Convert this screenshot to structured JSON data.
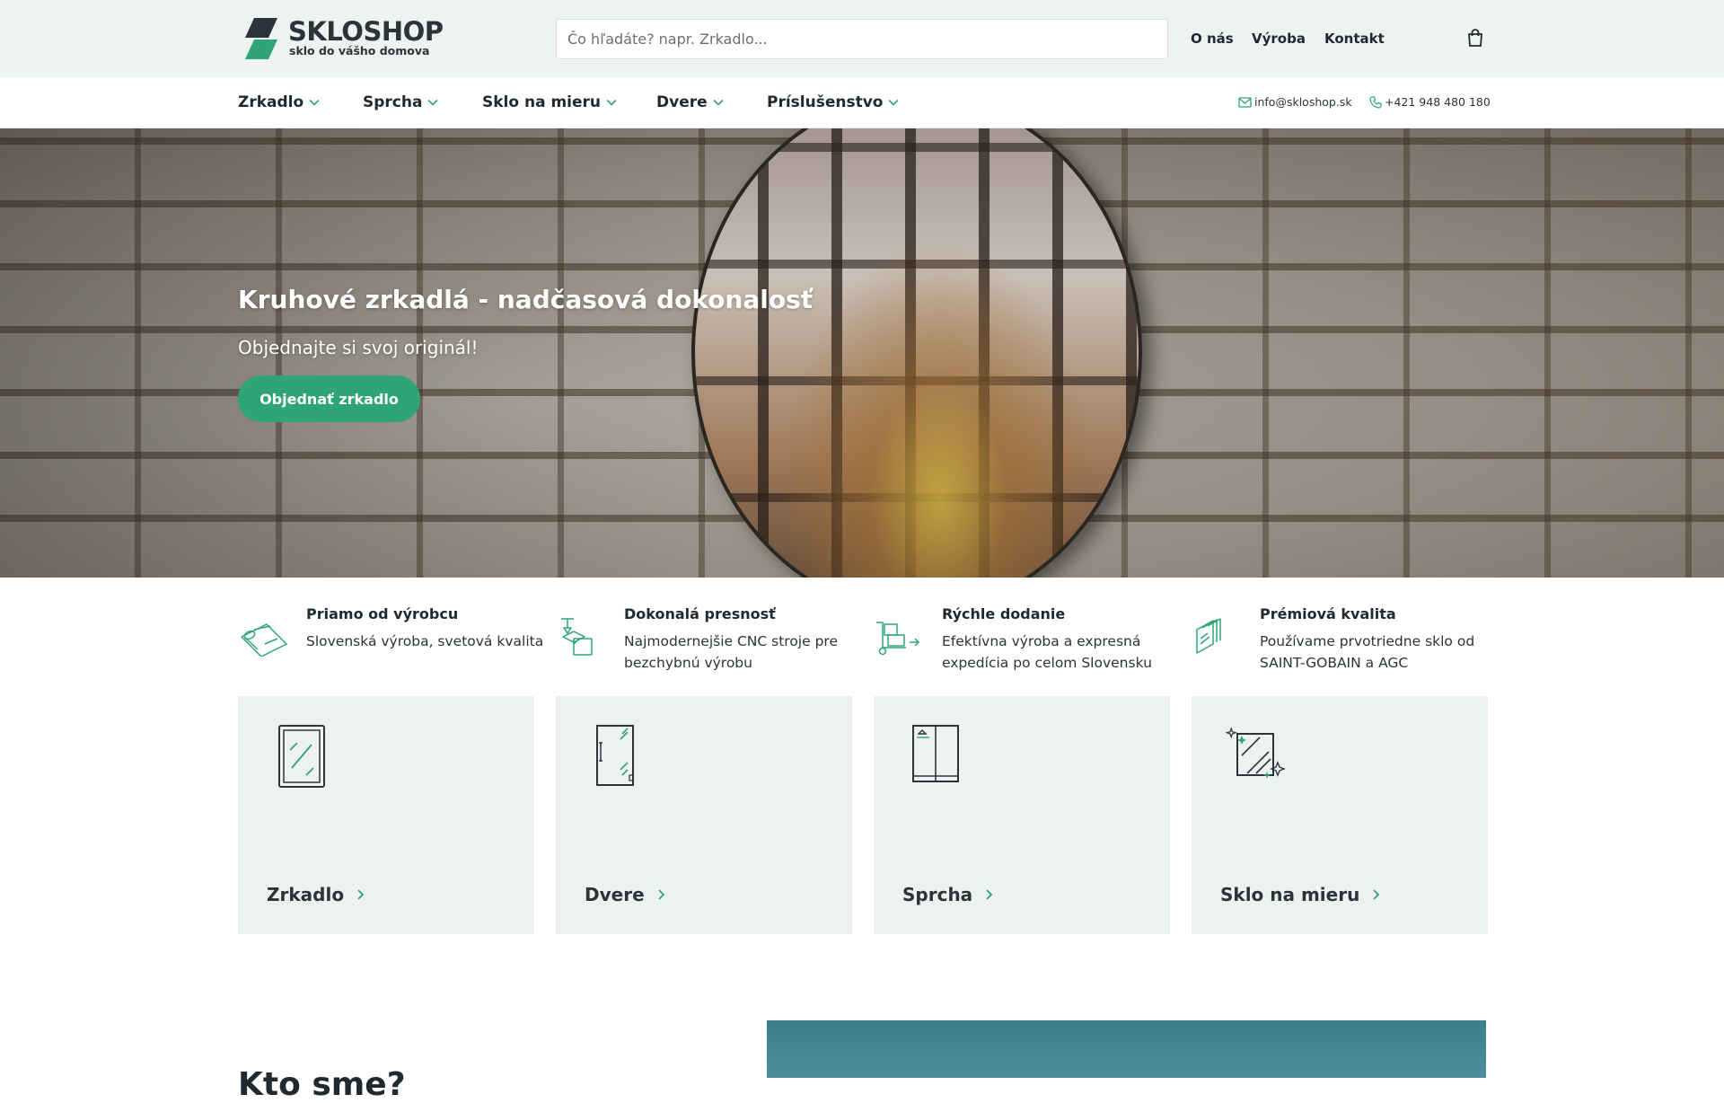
{
  "brand": {
    "name": "SKLOSHOP",
    "tagline": "sklo do vášho domova"
  },
  "search": {
    "placeholder": "Čo hľadáte? napr. Zrkadlo...",
    "value": ""
  },
  "top_nav": [
    {
      "label": "O nás"
    },
    {
      "label": "Výroba"
    },
    {
      "label": "Kontakt"
    }
  ],
  "categories_nav": [
    {
      "label": "Zrkadlo"
    },
    {
      "label": "Sprcha"
    },
    {
      "label": "Sklo na mieru"
    },
    {
      "label": "Dvere"
    },
    {
      "label": "Príslušenstvo"
    }
  ],
  "contact": {
    "email": "info@skloshop.sk",
    "phone": "+421 948 480 180"
  },
  "hero": {
    "title": "Kruhové zrkadlá - nadčasová dokonalosť",
    "subtitle": "Objednajte si svoj originál!",
    "cta": "Objednať zrkadlo"
  },
  "features": [
    {
      "title": "Priamo od výrobcu",
      "description": "Slovenská výroba, svetová kvalita",
      "icon": "glass-roll-icon"
    },
    {
      "title": "Dokonalá presnosť",
      "description": "Najmodernejšie CNC stroje pre bezchybnú výrobu",
      "icon": "cnc-machine-icon"
    },
    {
      "title": "Rýchle dodanie",
      "description": "Efektívna výroba a expresná expedícia po celom Slovensku",
      "icon": "delivery-cart-icon"
    },
    {
      "title": "Prémiová kvalita",
      "description": "Používame prvotriedne sklo od SAINT-GOBAIN a AGC",
      "icon": "glass-sheets-icon"
    }
  ],
  "category_cards": [
    {
      "label": "Zrkadlo",
      "icon": "mirror-icon"
    },
    {
      "label": "Dvere",
      "icon": "glass-door-icon"
    },
    {
      "label": "Sprcha",
      "icon": "shower-enclosure-icon"
    },
    {
      "label": "Sklo na mieru",
      "icon": "custom-glass-icon"
    }
  ],
  "about": {
    "title": "Kto sme?"
  },
  "colors": {
    "accent": "#2fa577",
    "header_bg": "#eef3f1",
    "card_bg": "#edf2f0",
    "text_dark": "#1f2a30"
  }
}
